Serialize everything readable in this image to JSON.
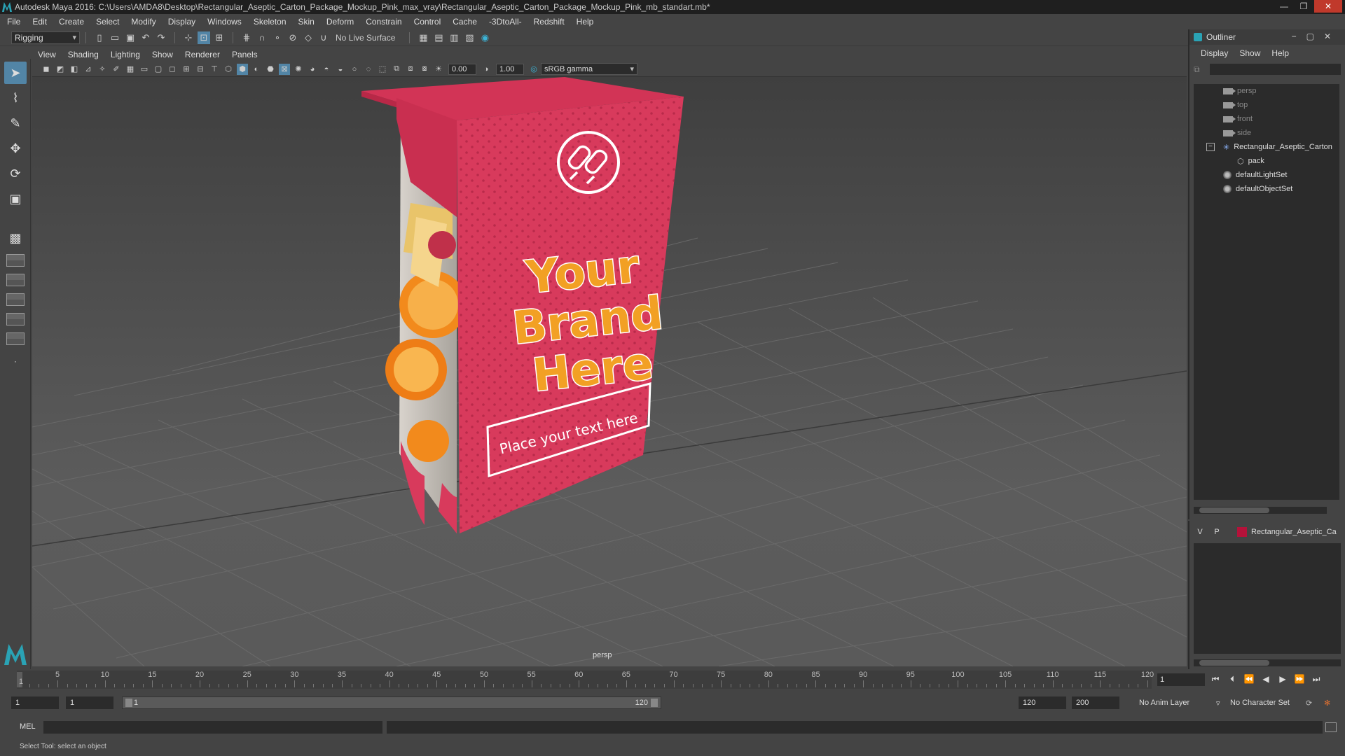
{
  "window": {
    "title": "Autodesk Maya 2016: C:\\Users\\AMDA8\\Desktop\\Rectangular_Aseptic_Carton_Package_Mockup_Pink_max_vray\\Rectangular_Aseptic_Carton_Package_Mockup_Pink_mb_standart.mb*"
  },
  "menubar": [
    "File",
    "Edit",
    "Create",
    "Select",
    "Modify",
    "Display",
    "Windows",
    "Skeleton",
    "Skin",
    "Deform",
    "Constrain",
    "Control",
    "Cache",
    "-3DtoAll-",
    "Redshift",
    "Help"
  ],
  "statusline": {
    "menuset": "Rigging",
    "live_surface": "No Live Surface"
  },
  "panel": {
    "menus": [
      "View",
      "Shading",
      "Lighting",
      "Show",
      "Renderer",
      "Panels"
    ],
    "exposure": "0.00",
    "gamma_value": "1.00",
    "color_space": "sRGB gamma",
    "camera_label": "persp"
  },
  "carton": {
    "headline": [
      "Your",
      "Brand",
      "Here"
    ],
    "tagline": "Place your text here",
    "colors": {
      "pink": "#d83a5c",
      "orange": "#f2a024"
    }
  },
  "outliner": {
    "title": "Outliner",
    "menus": [
      "Display",
      "Show",
      "Help"
    ],
    "items": [
      {
        "label": "persp",
        "icon": "camera-icon"
      },
      {
        "label": "top",
        "icon": "camera-icon"
      },
      {
        "label": "front",
        "icon": "camera-icon"
      },
      {
        "label": "side",
        "icon": "camera-icon"
      },
      {
        "label": "Rectangular_Aseptic_Carton",
        "icon": "group-icon"
      },
      {
        "label": "pack",
        "icon": "mesh-icon"
      },
      {
        "label": "defaultLightSet",
        "icon": "set-icon"
      },
      {
        "label": "defaultObjectSet",
        "icon": "set-icon"
      }
    ]
  },
  "layers": {
    "visible": "V",
    "playback": "P",
    "name": "Rectangular_Aseptic_Ca",
    "color": "#b5123a"
  },
  "timeline": {
    "labels": [
      "1",
      "5",
      "10",
      "15",
      "20",
      "25",
      "30",
      "35",
      "40",
      "45",
      "50",
      "55",
      "60",
      "65",
      "70",
      "75",
      "80",
      "85",
      "90",
      "95",
      "100",
      "105",
      "110",
      "115",
      "120"
    ],
    "current_frame": "1"
  },
  "range": {
    "start": "1",
    "anim_start": "1",
    "bar_start": "1",
    "bar_end": "120",
    "anim_end": "120",
    "end": "200",
    "anim_layer": "No Anim Layer",
    "character_set": "No Character Set"
  },
  "command": {
    "label": "MEL",
    "help": "Select Tool: select an object"
  }
}
